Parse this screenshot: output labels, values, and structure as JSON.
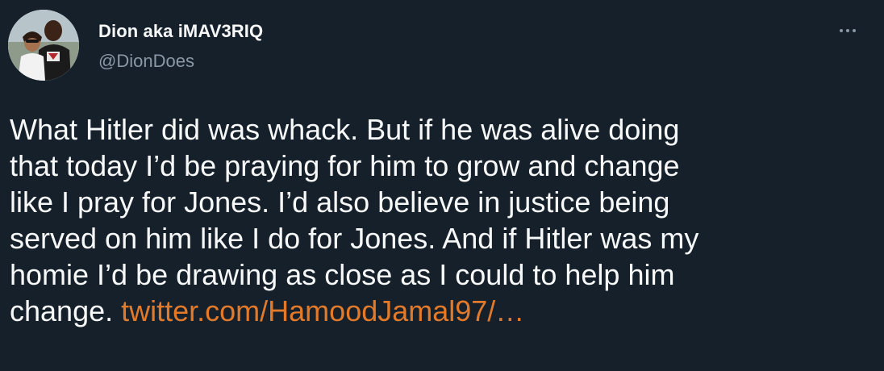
{
  "author": {
    "display_name": "Dion aka iMAV3RIQ",
    "handle": "@DionDoes",
    "avatar_icon": "profile-photo"
  },
  "menu": {
    "icon": "more-horizontal-icon"
  },
  "tweet": {
    "lines": [
      "What Hitler did was whack. But if he was alive doing",
      "that today I’d be praying for him to grow and change",
      "like I pray for Jones. I’d also believe in justice being",
      "served on him like I do for Jones. And if Hitler was my",
      "homie I’d be drawing as close as I could to help him"
    ],
    "last_line_text": "change.",
    "link_text": "twitter.com/HamoodJamal97/…"
  },
  "colors": {
    "background": "#15202b",
    "primary_text": "#f7f9f9",
    "secondary_text": "#8b98a5",
    "link": "#e27a2a"
  }
}
